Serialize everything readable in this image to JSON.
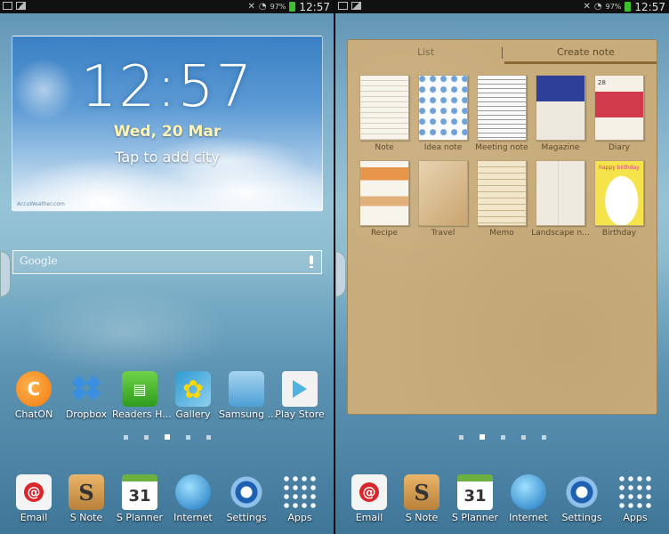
{
  "status_bar": {
    "battery_percent": "97%",
    "time": "12:57"
  },
  "left_screen": {
    "weather_widget": {
      "time": "12:57",
      "date": "Wed, 20 Mar",
      "city_prompt": "Tap to add city",
      "credit": "AccuWeather.com"
    },
    "google_search": {
      "label": "Google"
    },
    "apps": [
      {
        "label": "ChatON",
        "icon": "chaton-icon"
      },
      {
        "label": "Dropbox",
        "icon": "dropbox-icon"
      },
      {
        "label": "Readers H...",
        "icon": "readers-hub-icon"
      },
      {
        "label": "Gallery",
        "icon": "gallery-icon"
      },
      {
        "label": "Samsung ...",
        "icon": "samsung-apps-icon"
      },
      {
        "label": "Play Store",
        "icon": "play-store-icon"
      }
    ],
    "page_indicator": {
      "count": 5,
      "active": 2
    }
  },
  "right_screen": {
    "snote_widget": {
      "tabs": [
        {
          "label": "List",
          "selected": false
        },
        {
          "label": "Create note",
          "selected": true
        }
      ],
      "templates": [
        {
          "label": "Note"
        },
        {
          "label": "Idea note"
        },
        {
          "label": "Meeting note"
        },
        {
          "label": "Magazine"
        },
        {
          "label": "Diary"
        },
        {
          "label": "Recipe"
        },
        {
          "label": "Travel"
        },
        {
          "label": "Memo"
        },
        {
          "label": "Landscape n..."
        },
        {
          "label": "Birthday"
        }
      ],
      "birthday_text": "happy birthday",
      "diary_date": "28"
    },
    "page_indicator": {
      "count": 5,
      "active": 1
    }
  },
  "dock": {
    "calendar_day": "31",
    "items": [
      {
        "label": "Email",
        "icon": "email-icon"
      },
      {
        "label": "S Note",
        "icon": "s-note-icon"
      },
      {
        "label": "S Planner",
        "icon": "s-planner-icon"
      },
      {
        "label": "Internet",
        "icon": "internet-icon"
      },
      {
        "label": "Settings",
        "icon": "settings-icon"
      },
      {
        "label": "Apps",
        "icon": "apps-grid-icon"
      }
    ]
  }
}
